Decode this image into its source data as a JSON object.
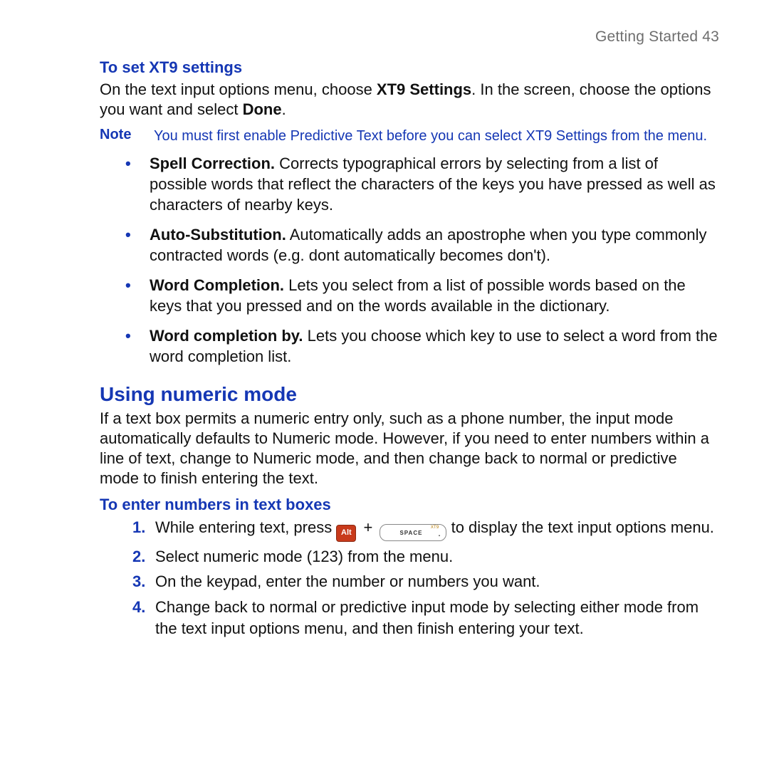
{
  "header": {
    "section": "Getting Started",
    "page": "43"
  },
  "xt9": {
    "heading": "To set XT9 settings",
    "intro_pre": "On the text input options menu, choose ",
    "intro_bold1": "XT9 Settings",
    "intro_mid": ". In the screen, choose the options you want and select ",
    "intro_bold2": "Done",
    "intro_post": ".",
    "note_label": "Note",
    "note_body": "You must first enable Predictive Text before you can select XT9 Settings from the menu.",
    "items": [
      {
        "title": "Spell Correction.",
        "body": " Corrects typographical errors by selecting from a list of possible words that reflect the characters of the keys you have pressed as well as characters of nearby keys."
      },
      {
        "title": "Auto-Substitution.",
        "body": " Automatically adds an apostrophe when you type commonly contracted words (e.g. dont automatically becomes don't)."
      },
      {
        "title": "Word Completion.",
        "body": " Lets you select from a list of possible words based on the keys that you pressed and on the words available in the dictionary."
      },
      {
        "title": "Word completion by.",
        "body": " Lets you choose which key to use to select a word from the word completion list."
      }
    ]
  },
  "numeric": {
    "heading": "Using numeric mode",
    "intro": "If a text box permits a numeric entry only, such as a phone number, the input mode automatically defaults to Numeric mode. However, if you need to enter numbers within a line of text, change to Numeric mode, and then change back to normal or predictive mode to finish entering the text.",
    "subhead": "To enter numbers in text boxes",
    "step1_pre": "While entering text, press ",
    "step1_post": " to display the text input options menu.",
    "step2": "Select numeric mode (123) from the menu.",
    "step3": "On the keypad, enter the number or numbers you want.",
    "step4": "Change back to normal or predictive input mode by selecting either mode from the text input options menu, and then finish entering your text."
  },
  "keys": {
    "alt": "Alt",
    "plus": "+",
    "space_top": "XT9",
    "space_main": "SPACE",
    "space_dot": "."
  }
}
